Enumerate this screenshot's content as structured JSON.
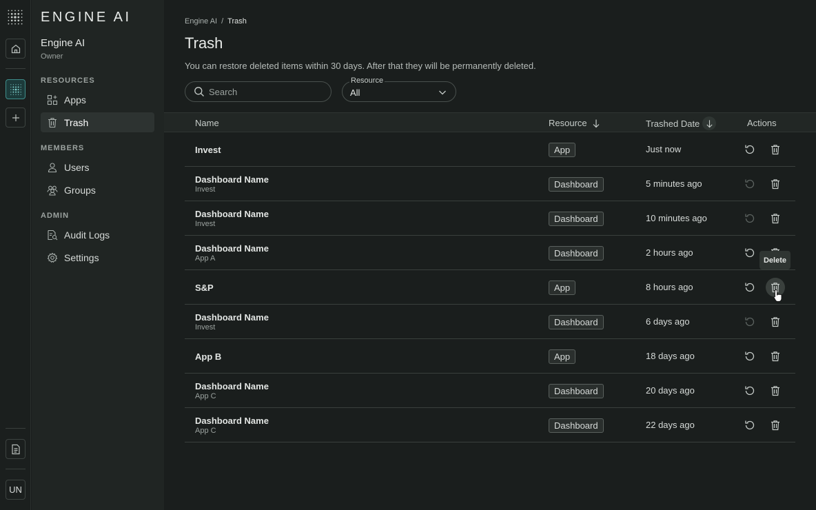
{
  "rail": {
    "user_initials": "UN"
  },
  "sidebar": {
    "logo": "ENGINE AI",
    "org_name": "Engine AI",
    "org_role": "Owner",
    "sections": {
      "resources": "RESOURCES",
      "members": "MEMBERS",
      "admin": "ADMIN"
    },
    "items": {
      "apps": "Apps",
      "trash": "Trash",
      "users": "Users",
      "groups": "Groups",
      "audit_logs": "Audit Logs",
      "settings": "Settings"
    },
    "selected": "Trash"
  },
  "breadcrumb": {
    "root": "Engine AI",
    "separator": "/",
    "current": "Trash"
  },
  "page": {
    "title": "Trash",
    "description": "You can restore deleted items within 30 days. After that they will be permanently deleted."
  },
  "filters": {
    "search_placeholder": "Search",
    "resource_label": "Resource",
    "resource_value": "All"
  },
  "table": {
    "headers": {
      "name": "Name",
      "resource": "Resource",
      "trashed_date": "Trashed Date",
      "actions": "Actions"
    },
    "rows": [
      {
        "name": "Invest",
        "sub": "",
        "resource": "App",
        "date": "Just now",
        "restore_enabled": true
      },
      {
        "name": "Dashboard Name",
        "sub": "Invest",
        "resource": "Dashboard",
        "date": "5 minutes ago",
        "restore_enabled": false
      },
      {
        "name": "Dashboard Name",
        "sub": "Invest",
        "resource": "Dashboard",
        "date": "10 minutes ago",
        "restore_enabled": false
      },
      {
        "name": "Dashboard Name",
        "sub": "App A",
        "resource": "Dashboard",
        "date": "2 hours ago",
        "restore_enabled": true
      },
      {
        "name": "S&P",
        "sub": "",
        "resource": "App",
        "date": "8 hours ago",
        "restore_enabled": true
      },
      {
        "name": "Dashboard Name",
        "sub": "Invest",
        "resource": "Dashboard",
        "date": "6 days ago",
        "restore_enabled": false
      },
      {
        "name": "App B",
        "sub": "",
        "resource": "App",
        "date": "18 days ago",
        "restore_enabled": true
      },
      {
        "name": "Dashboard Name",
        "sub": "App C",
        "resource": "Dashboard",
        "date": "20 days ago",
        "restore_enabled": true
      },
      {
        "name": "Dashboard Name",
        "sub": "App C",
        "resource": "Dashboard",
        "date": "22 days ago",
        "restore_enabled": true
      }
    ]
  },
  "tooltip": {
    "text": "Delete",
    "row_index": 4
  },
  "colors": {
    "accent": "#3f8f8c",
    "background": "#1a1e1d",
    "sidebar": "#202523"
  }
}
